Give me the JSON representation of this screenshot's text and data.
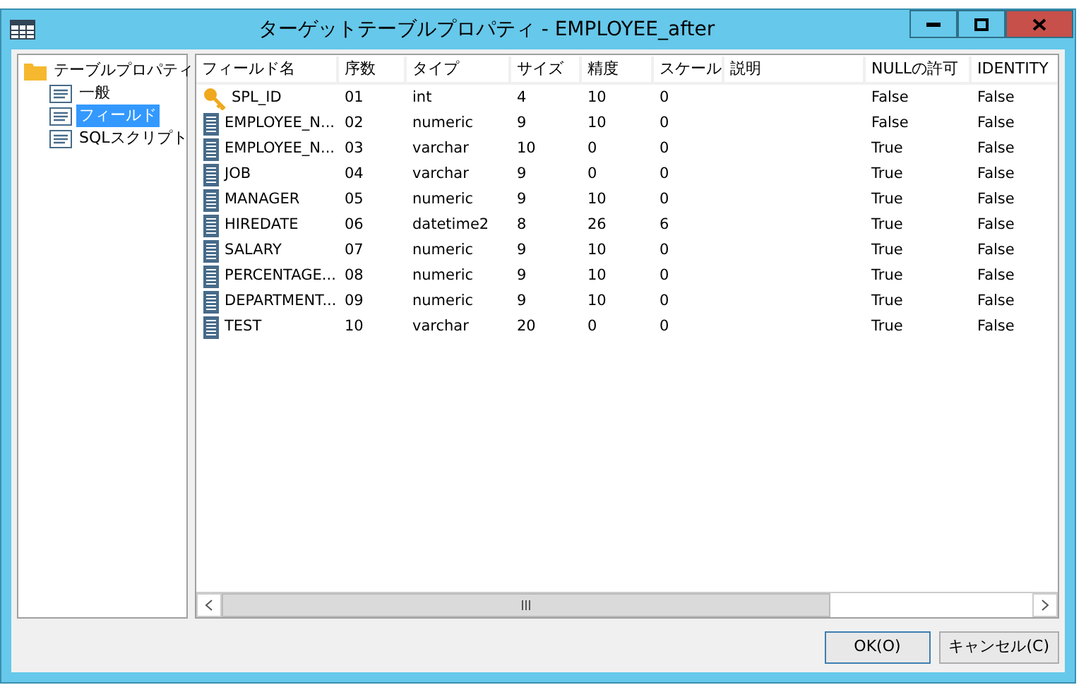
{
  "window": {
    "title": "ターゲットテーブルプロパティ - EMPLOYEE_after"
  },
  "tree": [
    {
      "label": "テーブルプロパティ",
      "selected": false,
      "children": [
        {
          "label": "一般",
          "selected": false
        },
        {
          "label": "フィールド",
          "selected": true
        },
        {
          "label": "SQLスクリプト",
          "selected": false
        }
      ]
    }
  ],
  "table": {
    "columns": [
      "フィールド名",
      "序数",
      "タイプ",
      "サイズ",
      "精度",
      "スケール",
      "説明",
      "NULLの許可",
      "IDENTITY"
    ],
    "rows": [
      {
        "kind": "key",
        "cells": [
          "SPL_ID",
          "01",
          "int",
          "4",
          "10",
          "0",
          "",
          "False",
          "False"
        ]
      },
      {
        "kind": "field",
        "cells": [
          "EMPLOYEE_N...",
          "02",
          "numeric",
          "9",
          "10",
          "0",
          "",
          "False",
          "False"
        ]
      },
      {
        "kind": "field",
        "cells": [
          "EMPLOYEE_N...",
          "03",
          "varchar",
          "10",
          "0",
          "0",
          "",
          "True",
          "False"
        ]
      },
      {
        "kind": "field",
        "cells": [
          "JOB",
          "04",
          "varchar",
          "9",
          "0",
          "0",
          "",
          "True",
          "False"
        ]
      },
      {
        "kind": "field",
        "cells": [
          "MANAGER",
          "05",
          "numeric",
          "9",
          "10",
          "0",
          "",
          "True",
          "False"
        ]
      },
      {
        "kind": "field",
        "cells": [
          "HIREDATE",
          "06",
          "datetime2",
          "8",
          "26",
          "6",
          "",
          "True",
          "False"
        ]
      },
      {
        "kind": "field",
        "cells": [
          "SALARY",
          "07",
          "numeric",
          "9",
          "10",
          "0",
          "",
          "True",
          "False"
        ]
      },
      {
        "kind": "field",
        "cells": [
          "PERCENTAGE...",
          "08",
          "numeric",
          "9",
          "10",
          "0",
          "",
          "True",
          "False"
        ]
      },
      {
        "kind": "field",
        "cells": [
          "DEPARTMENT...",
          "09",
          "numeric",
          "9",
          "10",
          "0",
          "",
          "True",
          "False"
        ]
      },
      {
        "kind": "field",
        "cells": [
          "TEST",
          "10",
          "varchar",
          "20",
          "0",
          "0",
          "",
          "True",
          "False"
        ]
      }
    ]
  },
  "buttons": [
    "OK(O)",
    "キャンセル(C)"
  ]
}
